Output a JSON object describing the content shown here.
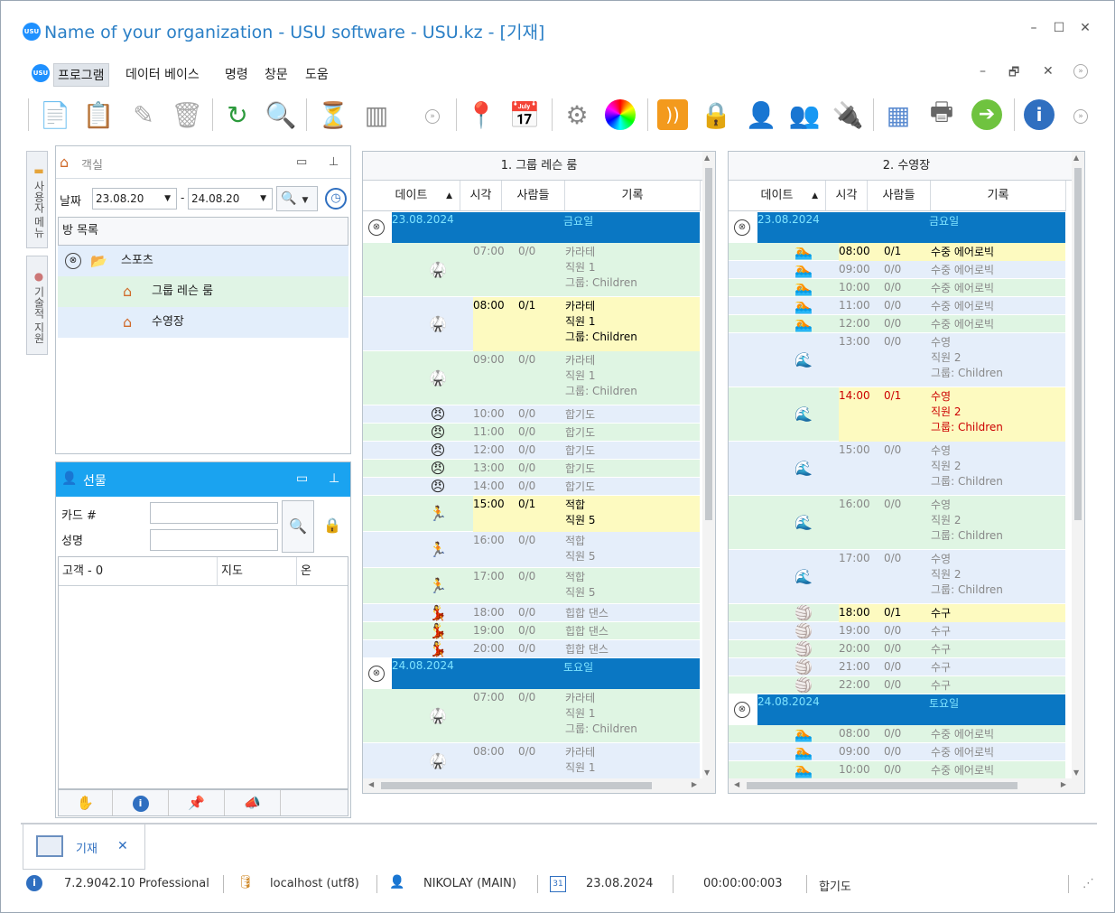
{
  "window": {
    "title": "Name of your organization - USU software - USU.kz - [기재]",
    "logo": "USU"
  },
  "menu": {
    "items": [
      "프로그램",
      "데이터 베이스",
      "명령",
      "창문",
      "도움"
    ]
  },
  "sidebar": {
    "tabs": [
      "사용자 메뉴",
      "기술적 지원"
    ]
  },
  "rooms_panel": {
    "title": "객실",
    "date_label": "날짜",
    "date_from": "23.08.20",
    "date_to": "24.08.20",
    "list_header": "방 목록",
    "tree": [
      {
        "label": "스포츠"
      },
      {
        "label": "그룹 레슨 룸"
      },
      {
        "label": "수영장"
      }
    ]
  },
  "gift_panel": {
    "title": "선물",
    "card_label": "카드 #",
    "name_label": "성명",
    "columns": [
      "고객 - 0",
      "지도",
      "온"
    ]
  },
  "schedules": [
    {
      "title": "1. 그룹 레슨 룸",
      "columns": [
        "데이트",
        "시각",
        "사람들",
        "기록"
      ],
      "days": [
        {
          "date": "23.08.2024",
          "dayname": "금요일",
          "rows": [
            {
              "icon": "karate-icon",
              "glyph": "🥋",
              "time": "07:00",
              "people": "0/0",
              "record": [
                "카라테",
                "직원 1",
                "그룹: Children"
              ],
              "hl": false
            },
            {
              "icon": "karate-icon",
              "glyph": "🥋",
              "time": "08:00",
              "people": "0/1",
              "record": [
                "카라테",
                "직원 1",
                "그룹: Children"
              ],
              "hl": true
            },
            {
              "icon": "karate-icon",
              "glyph": "🥋",
              "time": "09:00",
              "people": "0/0",
              "record": [
                "카라테",
                "직원 1",
                "그룹: Children"
              ],
              "hl": false
            },
            {
              "icon": "aikido-icon",
              "glyph": "😠",
              "time": "10:00",
              "people": "0/0",
              "record": [
                "합기도"
              ],
              "hl": false
            },
            {
              "icon": "aikido-icon",
              "glyph": "😠",
              "time": "11:00",
              "people": "0/0",
              "record": [
                "합기도"
              ],
              "hl": false
            },
            {
              "icon": "aikido-icon",
              "glyph": "😠",
              "time": "12:00",
              "people": "0/0",
              "record": [
                "합기도"
              ],
              "hl": false
            },
            {
              "icon": "aikido-icon",
              "glyph": "😠",
              "time": "13:00",
              "people": "0/0",
              "record": [
                "합기도"
              ],
              "hl": false
            },
            {
              "icon": "aikido-icon",
              "glyph": "😠",
              "time": "14:00",
              "people": "0/0",
              "record": [
                "합기도"
              ],
              "hl": false
            },
            {
              "icon": "step-icon",
              "glyph": "🏃",
              "time": "15:00",
              "people": "0/1",
              "record": [
                "적합",
                "직원 5"
              ],
              "hl": true
            },
            {
              "icon": "step-icon",
              "glyph": "🏃",
              "time": "16:00",
              "people": "0/0",
              "record": [
                "적합",
                "직원 5"
              ],
              "hl": false
            },
            {
              "icon": "step-icon",
              "glyph": "🏃",
              "time": "17:00",
              "people": "0/0",
              "record": [
                "적합",
                "직원 5"
              ],
              "hl": false
            },
            {
              "icon": "hiphop-icon",
              "glyph": "💃",
              "time": "18:00",
              "people": "0/0",
              "record": [
                "힙합 댄스"
              ],
              "hl": false
            },
            {
              "icon": "hiphop-icon",
              "glyph": "💃",
              "time": "19:00",
              "people": "0/0",
              "record": [
                "힙합 댄스"
              ],
              "hl": false
            },
            {
              "icon": "hiphop-icon",
              "glyph": "💃",
              "time": "20:00",
              "people": "0/0",
              "record": [
                "힙합 댄스"
              ],
              "hl": false
            }
          ]
        },
        {
          "date": "24.08.2024",
          "dayname": "토요일",
          "rows": [
            {
              "icon": "karate-icon",
              "glyph": "🥋",
              "time": "07:00",
              "people": "0/0",
              "record": [
                "카라테",
                "직원 1",
                "그룹: Children"
              ],
              "hl": false
            },
            {
              "icon": "karate-icon",
              "glyph": "🥋",
              "time": "08:00",
              "people": "0/0",
              "record": [
                "카라테",
                "직원 1"
              ],
              "hl": false
            }
          ]
        }
      ]
    },
    {
      "title": "2. 수영장",
      "columns": [
        "데이트",
        "시각",
        "사람들",
        "기록"
      ],
      "days": [
        {
          "date": "23.08.2024",
          "dayname": "금요일",
          "rows": [
            {
              "icon": "aqua-aerobics-icon",
              "glyph": "🏊",
              "time": "08:00",
              "people": "0/1",
              "record": [
                "수중 에어로빅"
              ],
              "hl": true
            },
            {
              "icon": "aqua-aerobics-icon",
              "glyph": "🏊",
              "time": "09:00",
              "people": "0/0",
              "record": [
                "수중 에어로빅"
              ],
              "hl": false
            },
            {
              "icon": "aqua-aerobics-icon",
              "glyph": "🏊",
              "time": "10:00",
              "people": "0/0",
              "record": [
                "수중 에어로빅"
              ],
              "hl": false
            },
            {
              "icon": "aqua-aerobics-icon",
              "glyph": "🏊",
              "time": "11:00",
              "people": "0/0",
              "record": [
                "수중 에어로빅"
              ],
              "hl": false
            },
            {
              "icon": "aqua-aerobics-icon",
              "glyph": "🏊",
              "time": "12:00",
              "people": "0/0",
              "record": [
                "수중 에어로빅"
              ],
              "hl": false
            },
            {
              "icon": "swimming-icon",
              "glyph": "🌊",
              "time": "13:00",
              "people": "0/0",
              "record": [
                "수영",
                "직원 2",
                "그룹: Children"
              ],
              "hl": false
            },
            {
              "icon": "swimming-icon",
              "glyph": "🌊",
              "time": "14:00",
              "people": "0/1",
              "record": [
                "수영",
                "직원 2",
                "그룹: Children"
              ],
              "hl": true,
              "red": true
            },
            {
              "icon": "swimming-icon",
              "glyph": "🌊",
              "time": "15:00",
              "people": "0/0",
              "record": [
                "수영",
                "직원 2",
                "그룹: Children"
              ],
              "hl": false
            },
            {
              "icon": "swimming-icon",
              "glyph": "🌊",
              "time": "16:00",
              "people": "0/0",
              "record": [
                "수영",
                "직원 2",
                "그룹: Children"
              ],
              "hl": false
            },
            {
              "icon": "swimming-icon",
              "glyph": "🌊",
              "time": "17:00",
              "people": "0/0",
              "record": [
                "수영",
                "직원 2",
                "그룹: Children"
              ],
              "hl": false
            },
            {
              "icon": "water-polo-icon",
              "glyph": "🏐",
              "time": "18:00",
              "people": "0/1",
              "record": [
                "수구"
              ],
              "hl": true
            },
            {
              "icon": "water-polo-icon",
              "glyph": "🏐",
              "time": "19:00",
              "people": "0/0",
              "record": [
                "수구"
              ],
              "hl": false
            },
            {
              "icon": "water-polo-icon",
              "glyph": "🏐",
              "time": "20:00",
              "people": "0/0",
              "record": [
                "수구"
              ],
              "hl": false
            },
            {
              "icon": "water-polo-icon",
              "glyph": "🏐",
              "time": "21:00",
              "people": "0/0",
              "record": [
                "수구"
              ],
              "hl": false
            },
            {
              "icon": "water-polo-icon",
              "glyph": "🏐",
              "time": "22:00",
              "people": "0/0",
              "record": [
                "수구"
              ],
              "hl": false
            }
          ]
        },
        {
          "date": "24.08.2024",
          "dayname": "토요일",
          "rows": [
            {
              "icon": "aqua-aerobics-icon",
              "glyph": "🏊",
              "time": "08:00",
              "people": "0/0",
              "record": [
                "수중 에어로빅"
              ],
              "hl": false
            },
            {
              "icon": "aqua-aerobics-icon",
              "glyph": "🏊",
              "time": "09:00",
              "people": "0/0",
              "record": [
                "수중 에어로빅"
              ],
              "hl": false
            },
            {
              "icon": "aqua-aerobics-icon",
              "glyph": "🏊",
              "time": "10:00",
              "people": "0/0",
              "record": [
                "수중 에어로빅"
              ],
              "hl": false
            }
          ]
        }
      ]
    }
  ],
  "doc_tab": {
    "label": "기재"
  },
  "status": {
    "version": "7.2.9042.10 Professional",
    "db": "localhost (utf8)",
    "user": "NIKOLAY (MAIN)",
    "date": "23.08.2024",
    "timer": "00:00:00:003",
    "module": "합기도"
  }
}
